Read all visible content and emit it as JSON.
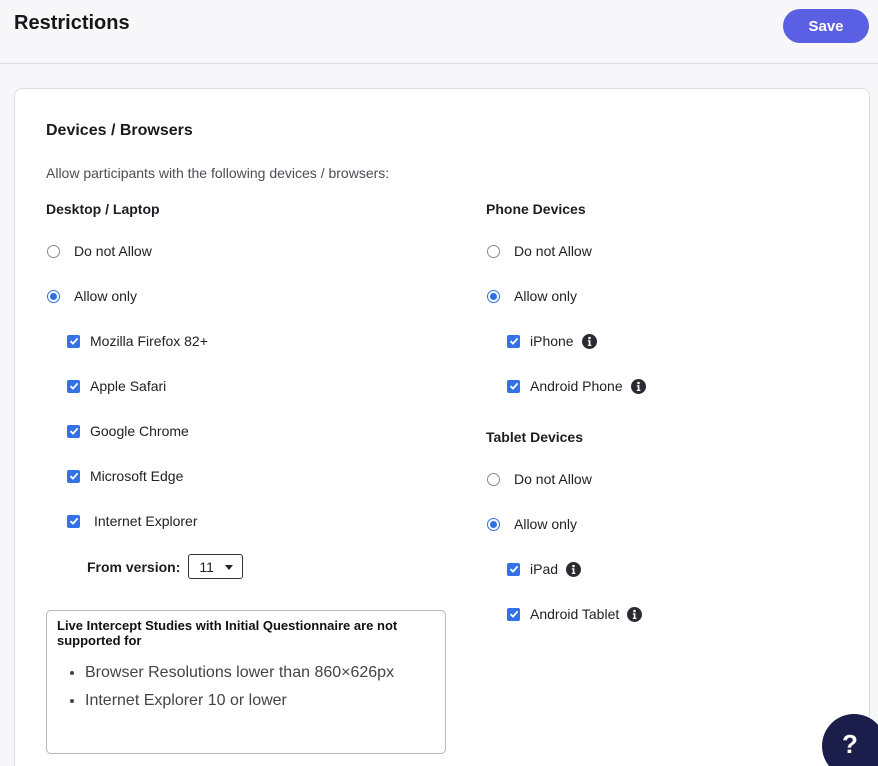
{
  "header": {
    "title": "Restrictions",
    "save_label": "Save"
  },
  "card": {
    "title": "Devices / Browsers",
    "description": "Allow participants with the following devices / browsers:"
  },
  "desktop": {
    "heading": "Desktop / Laptop",
    "do_not_allow_label": "Do not Allow",
    "allow_only_label": "Allow only",
    "selected": "Allow only",
    "browsers": [
      {
        "label": "Mozilla Firefox 82+",
        "checked": true
      },
      {
        "label": "Apple Safari",
        "checked": true
      },
      {
        "label": "Google Chrome",
        "checked": true
      },
      {
        "label": "Microsoft Edge",
        "checked": true
      },
      {
        "label": "Internet Explorer",
        "checked": true
      }
    ],
    "version_label": "From version:",
    "version_value": "11"
  },
  "phone": {
    "heading": "Phone Devices",
    "do_not_allow_label": "Do not Allow",
    "allow_only_label": "Allow only",
    "selected": "Allow only",
    "devices": [
      {
        "label": "iPhone",
        "checked": true,
        "icon": "info-icon"
      },
      {
        "label": "Android Phone",
        "checked": true,
        "icon": "info-icon"
      }
    ]
  },
  "tablet": {
    "heading": "Tablet Devices",
    "do_not_allow_label": "Do not Allow",
    "allow_only_label": "Allow only",
    "selected": "Allow only",
    "devices": [
      {
        "label": "iPad",
        "checked": true,
        "icon": "info-icon"
      },
      {
        "label": "Android Tablet",
        "checked": true,
        "icon": "info-icon"
      }
    ]
  },
  "notice": {
    "title": "Live Intercept Studies with Initial Questionnaire are not supported for",
    "items": [
      "Browser Resolutions lower than 860×626px",
      "Internet Explorer 10 or lower"
    ]
  },
  "help": {
    "label": "?",
    "icon": "help-icon"
  },
  "colors": {
    "accent": "#5b5fe3",
    "checkbox": "#3271e6",
    "help_bubble": "#1b1d4a"
  }
}
